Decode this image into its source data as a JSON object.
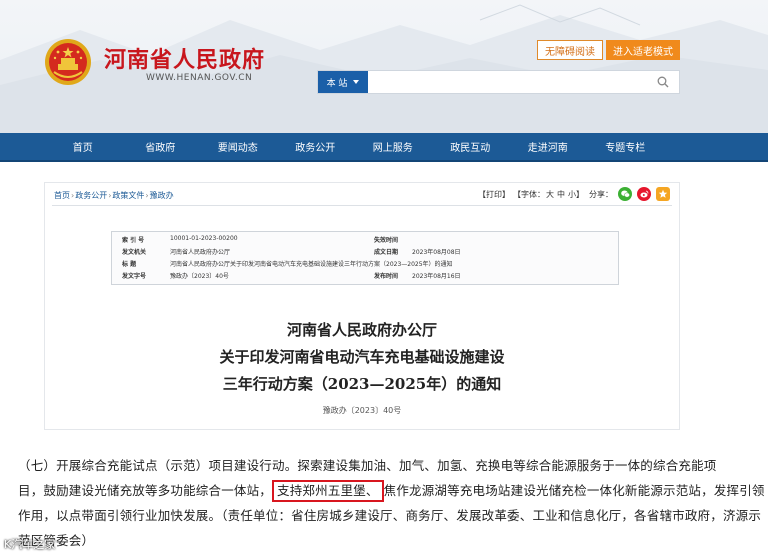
{
  "header": {
    "site_title": "河南省人民政府",
    "site_url": "WWW.HENAN.GOV.CN",
    "btn_access": "无障碍阅读",
    "btn_elder": "进入适老模式",
    "search_scope": "本 站",
    "search_placeholder": ""
  },
  "nav": {
    "items": [
      "首页",
      "省政府",
      "要闻动态",
      "政务公开",
      "网上服务",
      "政民互动",
      "走进河南",
      "专题专栏"
    ]
  },
  "breadcrumb": {
    "items": [
      "首页",
      "政务公开",
      "政策文件",
      "豫政办"
    ]
  },
  "tools": {
    "print": "【打印】",
    "font": "【字体：",
    "font_large": "大",
    "font_mid": "中",
    "font_small": "小",
    "font_end": "】",
    "share": "分享："
  },
  "meta": {
    "row1_label": "索 引 号",
    "row1_value": "10001-01-2023-00200",
    "row1_label2": "失效时间",
    "row1_value2": "",
    "row2_label": "发文机关",
    "row2_value": "河南省人民政府办公厅",
    "row2_label2": "成文日期",
    "row2_value2": "2023年08月08日",
    "row3_label": "标    题",
    "row3_value": "河南省人民政府办公厅关于印发河南省电动汽车充电基础设施建设三年行动方案（2023—2025年）的通知",
    "row4_label": "发文字号",
    "row4_value": "豫政办〔2023〕40号",
    "row4_label2": "发布时间",
    "row4_value2": "2023年08月16日"
  },
  "document": {
    "title_line1": "河南省人民政府办公厅",
    "title_line2": "关于印发河南省电动汽车充电基础设施建设",
    "title_line3": "三年行动方案（2023—2025年）的通知",
    "doc_number": "豫政办〔2023〕40号"
  },
  "excerpt": {
    "line1": "（七）开展综合充能试点（示范）项目建设行动。探索建设集加油、加气、加氢、充换电等综合能源服务于一体的综合充能项",
    "line2_before": "目，鼓励建设光储充放等多功能综合一体站，",
    "line2_highlight": "支持郑州五里堡、",
    "line2_after": "焦作龙源湖等充电场站建设光储充检一体化新能源示范站，发挥引领",
    "line3": "作用，以点带面引领行业加快发展。（责任单位：省住房城乡建设厅、商务厅、发展改革委、工业和信息化厅，各省辖市政府，济源示",
    "line4": "范区管委会）"
  },
  "watermark": "K汽车之家"
}
